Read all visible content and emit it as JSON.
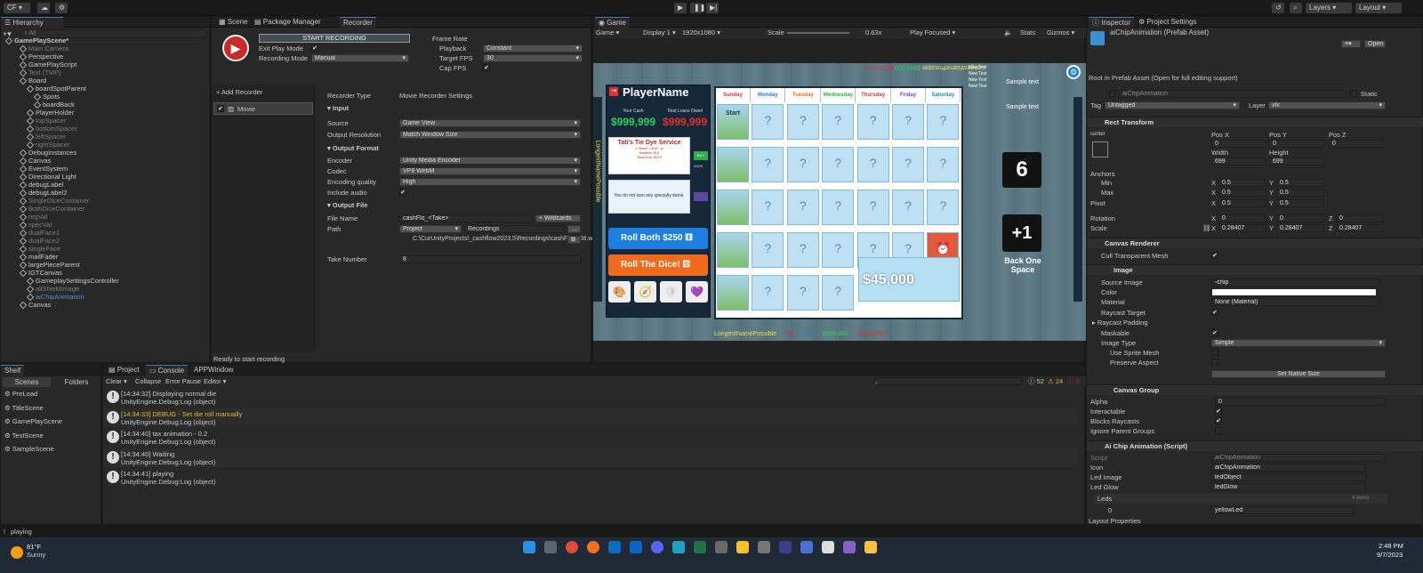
{
  "toolbar": {
    "account": "CF",
    "layers": "Layers",
    "layout": "Layout"
  },
  "hierarchy": {
    "tab": "Hierarchy",
    "search_placeholder": "All",
    "items": [
      {
        "label": "GamePlayScene*",
        "indent": 0,
        "bold": true,
        "dim": false
      },
      {
        "label": "Main Camera",
        "indent": 2,
        "dim": true
      },
      {
        "label": "Perspective",
        "indent": 2,
        "dim": false
      },
      {
        "label": "GamePlayScript",
        "indent": 2,
        "dim": false
      },
      {
        "label": "Text (TMP)",
        "indent": 2,
        "dim": true
      },
      {
        "label": "Board",
        "indent": 2,
        "dim": false
      },
      {
        "label": "boardSpotParent",
        "indent": 3,
        "dim": false
      },
      {
        "label": "Spots",
        "indent": 4,
        "dim": false
      },
      {
        "label": "boardBack",
        "indent": 4,
        "dim": false
      },
      {
        "label": "PlayerHolder",
        "indent": 3,
        "dim": false
      },
      {
        "label": "topSpacer",
        "indent": 3,
        "dim": true
      },
      {
        "label": "bottomSpacer",
        "indent": 3,
        "dim": true
      },
      {
        "label": "leftSpacer",
        "indent": 3,
        "dim": true
      },
      {
        "label": "rightSpacer",
        "indent": 3,
        "dim": true
      },
      {
        "label": "DebugInstances",
        "indent": 2,
        "dim": false
      },
      {
        "label": "Canvas",
        "indent": 2,
        "dim": false
      },
      {
        "label": "EventSystem",
        "indent": 2,
        "dim": false
      },
      {
        "label": "Directional Light",
        "indent": 2,
        "dim": false
      },
      {
        "label": "debugLabel",
        "indent": 2,
        "dim": false
      },
      {
        "label": "debugLabel2",
        "indent": 2,
        "dim": false
      },
      {
        "label": "SingleDiceContainer",
        "indent": 2,
        "dim": true
      },
      {
        "label": "BothDiceContainer",
        "indent": 2,
        "dim": true
      },
      {
        "label": "regVal",
        "indent": 2,
        "dim": true
      },
      {
        "label": "specVal",
        "indent": 2,
        "dim": true
      },
      {
        "label": "dualFace1",
        "indent": 2,
        "dim": true
      },
      {
        "label": "dualFace2",
        "indent": 2,
        "dim": true
      },
      {
        "label": "singleFace",
        "indent": 2,
        "dim": true
      },
      {
        "label": "mailFader",
        "indent": 2,
        "dim": false
      },
      {
        "label": "largePieceParent",
        "indent": 2,
        "dim": false
      },
      {
        "label": "IGTCanvas",
        "indent": 2,
        "dim": false
      },
      {
        "label": "GameplaySettingsController",
        "indent": 3,
        "dim": false
      },
      {
        "label": "allShieldImage",
        "indent": 3,
        "dim": true
      },
      {
        "label": "aiChipAnimation",
        "indent": 3,
        "dim": true,
        "selected": true
      },
      {
        "label": "Canvas",
        "indent": 2,
        "dim": false
      }
    ]
  },
  "recorder": {
    "tabs": [
      "Scene",
      "Package Manager",
      "Recorder"
    ],
    "start_btn": "START RECORDING",
    "exit_play_mode": "Exit Play Mode",
    "recording_mode_label": "Recording Mode",
    "recording_mode": "Manual",
    "frame_rate": "Frame Rate",
    "playback_label": "Playback",
    "playback": "Constant",
    "target_fps_label": "Target FPS",
    "target_fps": "30",
    "cap_fps": "Cap FPS",
    "add_recorder": "+ Add Recorder",
    "recorder_item": "Movie",
    "recorder_type_label": "Recorder Type",
    "recorder_type": "Movie Recorder Settings",
    "input": "Input",
    "source_label": "Source",
    "source": "Game View",
    "output_res_label": "Output Resolution",
    "output_res": "Match Window Size",
    "output_format": "Output Format",
    "encoder_label": "Encoder",
    "encoder": "Unity Media Encoder",
    "codec_label": "Codec",
    "codec": "VP8 WebM",
    "quality_label": "Encoding quality",
    "quality": "High",
    "include_audio": "Include audio",
    "output_file": "Output File",
    "file_name_label": "File Name",
    "file_name": "cashFlo_<Take>",
    "wildcards": "+ Wildcards",
    "path_label": "Path",
    "path_type": "Project",
    "path_folder": "Recordings",
    "full_path": "C:\\CurUnityProjects\\_cashflow2023.5\\Recordings\\cashFlo_008.webm",
    "take_label": "Take Number",
    "take": "8",
    "status": "Ready to start recording"
  },
  "game": {
    "tab": "Game",
    "mode": "Game",
    "display": "Display 1",
    "resolution": "1920x1080",
    "scale_label": "Scale",
    "scale": "0.63x",
    "play_focused": "Play Focused",
    "stats": "Stats",
    "gizmos": "Gizmos",
    "player_name": "PlayerName",
    "your_cash_label": "Your Cash",
    "your_cash": "$999,999",
    "total_loans_label": "Total Loans Owed",
    "total_loans": "$999,999",
    "card_title": "Tati's Tie Dye Service",
    "card_l1": "1 Share = $10 / yr",
    "card_l2": "Balance $10",
    "card_l3": "Total Due: $270",
    "card_count": "00/00",
    "buy": "BUY",
    "no_specialty": "You do not own any specialty items.",
    "roll_both": "Roll Both $250",
    "roll_dice": "Roll The Dice!",
    "days": [
      "Sunday",
      "Monday",
      "Tuesday",
      "Wednesday",
      "Thursday",
      "Friday",
      "Saturday"
    ],
    "start": "Start",
    "prize": "$45,000",
    "sample_text": "Sample text",
    "die_value": "6",
    "plus_one": "+1",
    "back_one": "Back One Space",
    "new_text": "New Text",
    "bottom_name": "LongestNamePossible",
    "bottom_v1": "99",
    "bottom_v2": "99",
    "bottom_v3": "$999,000",
    "bottom_v4": "$575,250",
    "top_name": "LongestNamePossible",
    "top_v1": "99",
    "top_v2": "99",
    "top_v3": "$999,000",
    "top_v4": "$575,250"
  },
  "inspector": {
    "tabs": [
      "Inspector",
      "Project Settings"
    ],
    "title": "aiChipAnimation (Prefab Asset)",
    "open": "Open",
    "root_note": "Root in Prefab Asset (Open for full editing support)",
    "name": "aiChipAnimation",
    "static": "Static",
    "tag_label": "Tag",
    "tag": "Untagged",
    "layer_label": "Layer",
    "layer": "vfx",
    "rect": {
      "title": "Rect Transform",
      "anchor": "center",
      "middle": "middle",
      "posx_l": "Pos X",
      "posy_l": "Pos Y",
      "posz_l": "Pos Z",
      "posx": "0",
      "posy": "0",
      "posz": "0",
      "width_l": "Width",
      "height_l": "Height",
      "width": "699",
      "height": "699",
      "anchors": "Anchors",
      "min": "Min",
      "max": "Max",
      "pivot": "Pivot",
      "minx": "0.5",
      "miny": "0.5",
      "maxx": "0.5",
      "maxy": "0.5",
      "pivx": "0.5",
      "pivy": "0.5",
      "rotation": "Rotation",
      "rotx": "0",
      "roty": "0",
      "rotz": "0",
      "scale": "Scale",
      "scx": "0.28407",
      "scy": "0.28407",
      "scz": "0.28407"
    },
    "canvas_renderer": {
      "title": "Canvas Renderer",
      "cull": "Cull Transparent Mesh"
    },
    "image": {
      "title": "Image",
      "source_l": "Source Image",
      "source": "chip",
      "color_l": "Color",
      "material_l": "Material",
      "material": "None (Material)",
      "raycast_target": "Raycast Target",
      "raycast_padding": "Raycast Padding",
      "maskable": "Maskable",
      "image_type_l": "Image Type",
      "image_type": "Simple",
      "use_sprite_mesh": "Use Sprite Mesh",
      "preserve": "Preserve Aspect",
      "native": "Set Native Size"
    },
    "canvas_group": {
      "title": "Canvas Group",
      "alpha_l": "Alpha",
      "alpha": "0",
      "interactable": "Interactable",
      "blocks": "Blocks Raycasts",
      "ignore": "Ignore Parent Groups"
    },
    "script": {
      "title": "Ai Chip Animation (Script)",
      "script_l": "Script",
      "script": "aiChipAnimation",
      "icon_l": "Icon",
      "icon": "aiChipAnimation",
      "led_image_l": "Led Image",
      "led_image": "ledObject",
      "led_glow_l": "Led Glow",
      "led_glow": "ledGlow",
      "leds": "Leds",
      "leds_count": "4 items",
      "led0_l": "0",
      "led0": "yellowLed"
    },
    "layout_props": "Layout Properties"
  },
  "shelf": {
    "tab": "Shelf",
    "scenes_tab": "Scenes",
    "folders_tab": "Folders",
    "scenes": [
      "PreLoad",
      "TitleScene",
      "GamePlayScene",
      "TestScene",
      "SampleScene"
    ]
  },
  "console": {
    "tabs": [
      "Project",
      "Console",
      "APPWindow"
    ],
    "clear": "Clear",
    "collapse": "Collapse",
    "error_pause": "Error Pause",
    "editor": "Editor",
    "count_log": "52",
    "count_warn": "24",
    "count_err": "0",
    "logs": [
      {
        "l1": "[14:34:32] Displaying normal die",
        "l2": "UnityEngine.Debug:Log (object)",
        "warn": false
      },
      {
        "l1": "[14:34:33] DEBUG - Set die roll manually",
        "l2": "UnityEngine.Debug:Log (object)",
        "warn": true
      },
      {
        "l1": "[14:34:40] tax animation - 0.2",
        "l2": "UnityEngine.Debug:Log (object)",
        "warn": false
      },
      {
        "l1": "[14:34:40] Waiting",
        "l2": "UnityEngine.Debug:Log (object)",
        "warn": false
      },
      {
        "l1": "[14:34:41] playing",
        "l2": "UnityEngine.Debug:Log (object)",
        "warn": false
      }
    ]
  },
  "statusbar": {
    "msg": "playing"
  },
  "taskbar": {
    "temp": "81°F",
    "weather": "Sunny",
    "time": "2:48 PM",
    "date": "9/7/2023"
  },
  "colors": {
    "accent": "#3a79bb",
    "record": "#c92b2b",
    "roll_blue": "#1f7fe0",
    "roll_orange": "#ee6a1c",
    "cash_green": "#2cd25a",
    "loan_red": "#e23131"
  }
}
